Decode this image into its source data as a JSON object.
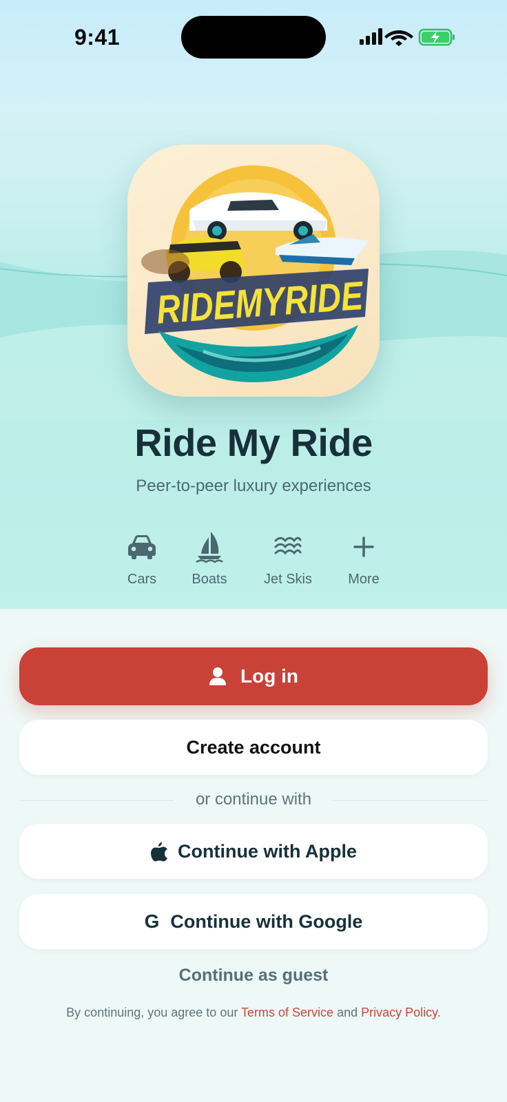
{
  "status_bar": {
    "time": "9:41"
  },
  "app": {
    "name": "Ride My Ride",
    "tagline": "Peer-to-peer luxury experiences",
    "logo_wordmark": "RIDEMYRIDE"
  },
  "categories": [
    {
      "label": "Cars",
      "icon": "car-icon"
    },
    {
      "label": "Boats",
      "icon": "sailboat-icon"
    },
    {
      "label": "Jet Skis",
      "icon": "waves-icon"
    },
    {
      "label": "More",
      "icon": "plus-icon"
    }
  ],
  "actions": {
    "login_label": "Log in",
    "create_account_label": "Create account",
    "divider_text": "or continue with",
    "apple_label": "Continue with Apple",
    "google_label": "Continue with Google",
    "google_glyph": "G",
    "guest_label": "Continue as guest"
  },
  "legal": {
    "prefix": "By continuing, you agree to our ",
    "terms": "Terms of Service",
    "middle": " and ",
    "privacy": "Privacy Policy",
    "suffix": "."
  },
  "colors": {
    "primary": "#c94137",
    "title": "#17303a",
    "link": "#c9453a"
  }
}
